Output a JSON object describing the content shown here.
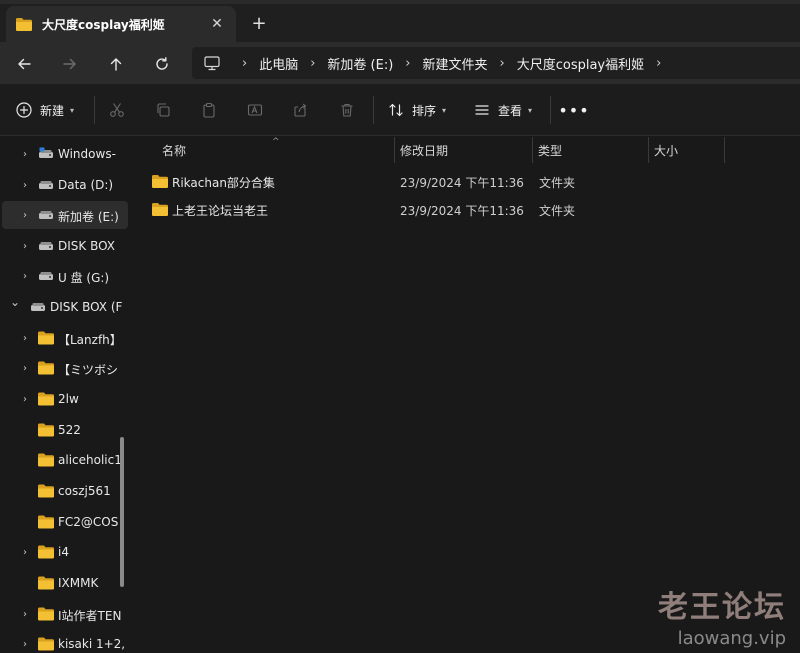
{
  "tab": {
    "title": "大尺度cosplay福利姬",
    "close_glyph": "✕",
    "new_tab_glyph": "+"
  },
  "breadcrumb": [
    "此电脑",
    "新加卷 (E:)",
    "新建文件夹",
    "大尺度cosplay福利姬"
  ],
  "breadcrumb_separator": "›",
  "toolbar": {
    "new_label": "新建",
    "sort_label": "排序",
    "view_label": "查看",
    "more_glyph": "•••"
  },
  "sidebar": {
    "items": [
      {
        "label": "Windows-",
        "icon": "drive-icon",
        "expandable": true,
        "expanded": false
      },
      {
        "label": "Data (D:)",
        "icon": "drive-icon",
        "expandable": true,
        "expanded": false
      },
      {
        "label": "新加卷 (E:)",
        "icon": "drive-icon",
        "expandable": true,
        "expanded": false,
        "selected": true
      },
      {
        "label": "DISK BOX",
        "icon": "drive-icon",
        "expandable": true,
        "expanded": false
      },
      {
        "label": "U 盘 (G:)",
        "icon": "drive-icon",
        "expandable": true,
        "expanded": false
      },
      {
        "label": "DISK BOX (F",
        "icon": "drive-icon",
        "expandable": true,
        "expanded": true
      },
      {
        "label": "【Lanzfh】",
        "icon": "folder-icon",
        "expandable": true,
        "expanded": false
      },
      {
        "label": "【ミツボシ",
        "icon": "folder-icon",
        "expandable": true,
        "expanded": false
      },
      {
        "label": "2lw",
        "icon": "folder-icon",
        "expandable": true,
        "expanded": false
      },
      {
        "label": "522",
        "icon": "folder-icon",
        "expandable": false
      },
      {
        "label": "aliceholic1",
        "icon": "folder-icon",
        "expandable": false
      },
      {
        "label": "coszj561",
        "icon": "folder-icon",
        "expandable": false
      },
      {
        "label": "FC2@COS",
        "icon": "folder-icon",
        "expandable": false
      },
      {
        "label": "i4",
        "icon": "folder-icon",
        "expandable": true,
        "expanded": false
      },
      {
        "label": "IXMMK",
        "icon": "folder-icon",
        "expandable": false
      },
      {
        "label": "I站作者TEN",
        "icon": "folder-icon",
        "expandable": true,
        "expanded": false
      },
      {
        "label": "kisaki 1+2,",
        "icon": "folder-icon",
        "expandable": true,
        "expanded": false
      }
    ]
  },
  "columns": {
    "name": "名称",
    "date": "修改日期",
    "type": "类型",
    "size": "大小"
  },
  "files": [
    {
      "name": "Rikachan部分合集",
      "date": "23/9/2024 下午11:36",
      "type": "文件夹",
      "size": ""
    },
    {
      "name": "上老王论坛当老王",
      "date": "23/9/2024 下午11:36",
      "type": "文件夹",
      "size": ""
    }
  ],
  "watermark": {
    "line1": "老王论坛",
    "line2": "laowang.vip"
  },
  "colors": {
    "folder": "#f4c033",
    "folder_dark": "#d9a11f",
    "background": "#191919",
    "panel": "#2b2b2b"
  }
}
